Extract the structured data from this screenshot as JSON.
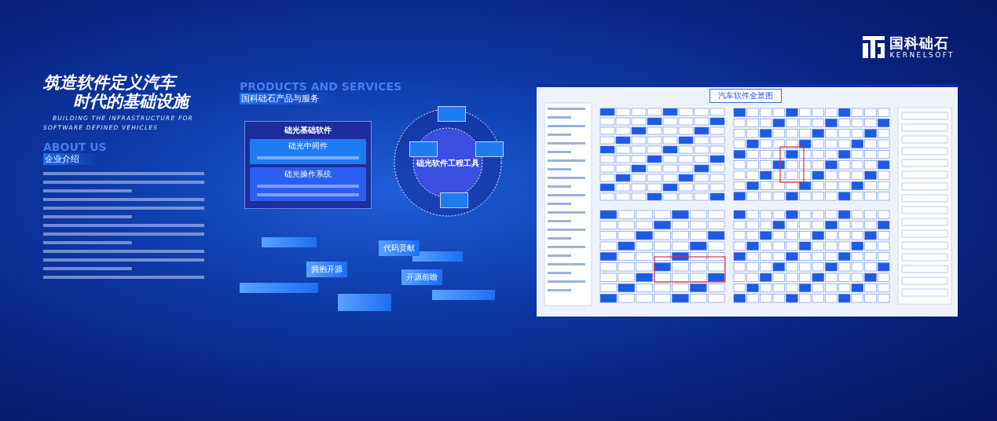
{
  "heading": {
    "title_lines": [
      "筑造软件定义汽车",
      "时代的基础设施"
    ],
    "subtitle_lines": [
      "BUILDING THE INFRASTRUCTURE FOR",
      "SOFTWARE DEFINED VEHICLES"
    ]
  },
  "about": {
    "watermark": "ABOUT US",
    "title": "企业介绍"
  },
  "products": {
    "watermark": "PRODUCTS AND SERVICES",
    "title": "国科础石产品与服务",
    "base_software": {
      "title": "础光基础软件",
      "groups": [
        "础光中间件",
        "础光操作系统"
      ]
    },
    "tools": {
      "title": "础光软件工程工具"
    }
  },
  "open_source": {
    "tags": [
      "代码贡献",
      "拥抱开源",
      "开源前瞻"
    ]
  },
  "panorama": {
    "title": "汽车软件全景图"
  },
  "logo": {
    "name": "国科础石",
    "english": "KERNELSOFT"
  }
}
